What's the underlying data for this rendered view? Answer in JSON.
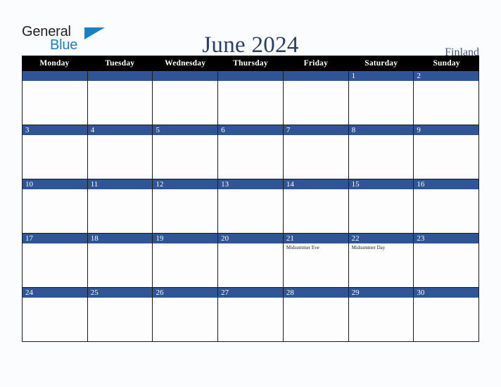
{
  "logo": {
    "text_primary": "General",
    "text_secondary": "Blue",
    "triangle_color": "#1b7fc4",
    "primary_color": "#231f20"
  },
  "header": {
    "title": "June 2024",
    "country": "Finland",
    "title_color": "#2b3f63",
    "country_color": "#41547a"
  },
  "calendar": {
    "weekday_header_bg": "#000000",
    "day_band_color": "#2f5597",
    "cell_bg": "#fdfdfe",
    "weekdays": [
      "Monday",
      "Tuesday",
      "Wednesday",
      "Thursday",
      "Friday",
      "Saturday",
      "Sunday"
    ],
    "weeks": [
      [
        {
          "day": "",
          "events": []
        },
        {
          "day": "",
          "events": []
        },
        {
          "day": "",
          "events": []
        },
        {
          "day": "",
          "events": []
        },
        {
          "day": "",
          "events": []
        },
        {
          "day": "1",
          "events": []
        },
        {
          "day": "2",
          "events": []
        }
      ],
      [
        {
          "day": "3",
          "events": []
        },
        {
          "day": "4",
          "events": []
        },
        {
          "day": "5",
          "events": []
        },
        {
          "day": "6",
          "events": []
        },
        {
          "day": "7",
          "events": []
        },
        {
          "day": "8",
          "events": []
        },
        {
          "day": "9",
          "events": []
        }
      ],
      [
        {
          "day": "10",
          "events": []
        },
        {
          "day": "11",
          "events": []
        },
        {
          "day": "12",
          "events": []
        },
        {
          "day": "13",
          "events": []
        },
        {
          "day": "14",
          "events": []
        },
        {
          "day": "15",
          "events": []
        },
        {
          "day": "16",
          "events": []
        }
      ],
      [
        {
          "day": "17",
          "events": []
        },
        {
          "day": "18",
          "events": []
        },
        {
          "day": "19",
          "events": []
        },
        {
          "day": "20",
          "events": []
        },
        {
          "day": "21",
          "events": [
            "Midsummer Eve"
          ]
        },
        {
          "day": "22",
          "events": [
            "Midsummer Day"
          ]
        },
        {
          "day": "23",
          "events": []
        }
      ],
      [
        {
          "day": "24",
          "events": []
        },
        {
          "day": "25",
          "events": []
        },
        {
          "day": "26",
          "events": []
        },
        {
          "day": "27",
          "events": []
        },
        {
          "day": "28",
          "events": []
        },
        {
          "day": "29",
          "events": []
        },
        {
          "day": "30",
          "events": []
        }
      ]
    ]
  }
}
